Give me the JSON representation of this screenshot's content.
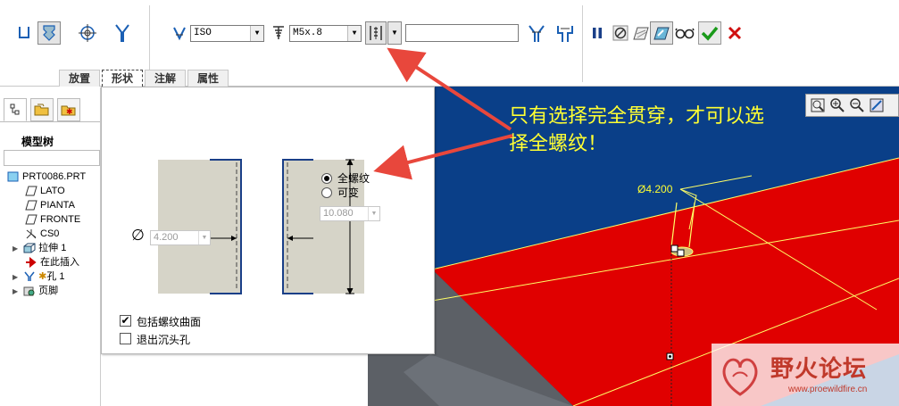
{
  "toolbar": {
    "standard_value": "ISO",
    "screw_size_value": "M5x.8",
    "depth_value_text": "",
    "tabs": [
      "放置",
      "形状",
      "注解",
      "属性"
    ],
    "active_tab": "形状"
  },
  "model_tree": {
    "title": "模型树",
    "items": [
      {
        "label": "PRT0086.PRT",
        "icon": "part-icon"
      },
      {
        "label": "LATO",
        "icon": "datum-plane-icon"
      },
      {
        "label": "PIANTA",
        "icon": "datum-plane-icon"
      },
      {
        "label": "FRONTE",
        "icon": "datum-plane-icon"
      },
      {
        "label": "CS0",
        "icon": "coordinate-system-icon"
      },
      {
        "label": "拉伸 1",
        "icon": "extrude-icon"
      },
      {
        "label": "在此插入",
        "icon": "insert-here-icon"
      },
      {
        "label": "孔 1",
        "icon": "hole-icon"
      },
      {
        "label": "页脚",
        "icon": "footer-icon"
      }
    ]
  },
  "shape_panel": {
    "diameter_value": "4.200",
    "radio_full_thread": "全螺纹",
    "radio_variable": "可变",
    "depth_value": "10.080",
    "checkbox_include_thread_surface": "包括螺纹曲面",
    "checkbox_exit_countersink": "退出沉头孔",
    "include_thread_surface_checked": true,
    "exit_countersink_checked": false
  },
  "viewport": {
    "dimension_label": "Ø4.200",
    "annotation": "只有选择完全贯穿，才可以选择全螺纹！"
  },
  "watermark": {
    "brand": "野火论坛",
    "url": "www.proewildfire.cn"
  },
  "colors": {
    "viewport_bg": "#0a3f88",
    "model_red": "#e00000",
    "annotation_text": "#ffff33",
    "arrow_red": "#e8473c",
    "confirm_green": "#1a9a1a",
    "cancel_red": "#d01010"
  }
}
